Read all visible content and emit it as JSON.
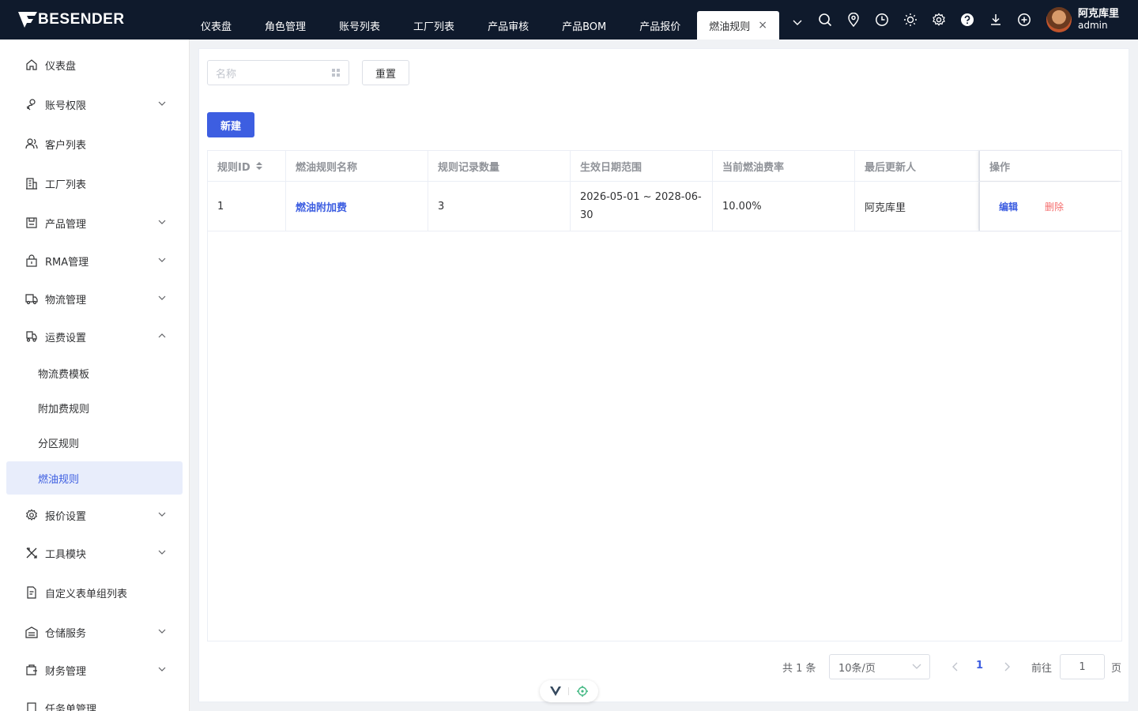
{
  "header": {
    "logo_text": "BESENDER",
    "tabs": [
      {
        "label": "仪表盘"
      },
      {
        "label": "角色管理"
      },
      {
        "label": "账号列表"
      },
      {
        "label": "工厂列表"
      },
      {
        "label": "产品审核"
      },
      {
        "label": "产品BOM"
      },
      {
        "label": "产品报价"
      },
      {
        "label": "燃油规则",
        "active": true
      }
    ],
    "tab_close": "×",
    "icons": [
      "search-icon",
      "location-icon",
      "clock-icon",
      "sun-icon",
      "gear-icon",
      "help-icon",
      "download-icon",
      "plus-circle-icon"
    ],
    "user": {
      "name": "阿克库里",
      "role": "admin"
    }
  },
  "sidebar": {
    "items": [
      {
        "label": "仪表盘",
        "icon": "home-icon"
      },
      {
        "label": "账号权限",
        "icon": "user-key-icon",
        "expandable": true
      },
      {
        "label": "客户列表",
        "icon": "users-icon"
      },
      {
        "label": "工厂列表",
        "icon": "building-icon"
      },
      {
        "label": "产品管理",
        "icon": "box-icon",
        "expandable": true
      },
      {
        "label": "RMA管理",
        "icon": "lock-bag-icon",
        "expandable": true
      },
      {
        "label": "物流管理",
        "icon": "truck-icon",
        "expandable": true
      },
      {
        "label": "运费设置",
        "icon": "freight-icon",
        "expandable": true,
        "expanded": true
      },
      {
        "label": "报价设置",
        "icon": "gear-icon",
        "expandable": true
      },
      {
        "label": "工具模块",
        "icon": "tools-icon",
        "expandable": true
      },
      {
        "label": "自定义表单组列表",
        "icon": "form-icon"
      },
      {
        "label": "仓储服务",
        "icon": "warehouse-icon",
        "expandable": true
      },
      {
        "label": "财务管理",
        "icon": "wallet-icon",
        "expandable": true
      },
      {
        "label": "任务单管理",
        "icon": "task-icon"
      }
    ],
    "sub_items": [
      {
        "label": "物流费模板"
      },
      {
        "label": "附加费规则"
      },
      {
        "label": "分区规则"
      },
      {
        "label": "燃油规则",
        "active": true
      }
    ]
  },
  "toolbar": {
    "search_placeholder": "名称",
    "reset_label": "重置",
    "new_label": "新建"
  },
  "table": {
    "columns": [
      "规则ID",
      "燃油规则名称",
      "规则记录数量",
      "生效日期范围",
      "当前燃油费率",
      "最后更新人",
      "操作"
    ],
    "rows": [
      {
        "id": "1",
        "name": "燃油附加费",
        "count": "3",
        "date_range": "2026-05-01 ~ 2028-06-30",
        "rate": "10.00%",
        "updater": "阿克库里",
        "edit": "编辑",
        "delete": "删除"
      }
    ]
  },
  "pagination": {
    "total": "共 1 条",
    "page_size": "10条/页",
    "current_page": "1",
    "goto_label": "前往",
    "goto_value": "1",
    "page_suffix": "页"
  },
  "colors": {
    "header_bg": "#0f1a2c",
    "primary": "#3d5ee1",
    "danger": "#f56c6c",
    "active_menu_bg": "#e8edfb"
  }
}
